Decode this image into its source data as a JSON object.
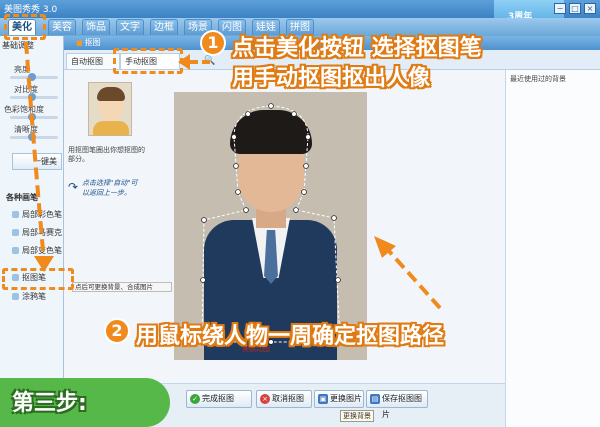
{
  "app": {
    "title": "美图秀秀 3.0",
    "logo_text": "3周年"
  },
  "window_controls": {
    "minimize": "−",
    "maximize": "□",
    "close": "×"
  },
  "main_tabs": [
    {
      "label": "美化"
    },
    {
      "label": "美容"
    },
    {
      "label": "饰品"
    },
    {
      "label": "文字"
    },
    {
      "label": "边框"
    },
    {
      "label": "场景"
    },
    {
      "label": "闪图"
    },
    {
      "label": "娃娃"
    },
    {
      "label": "拼图"
    }
  ],
  "left_panel": {
    "header": "基础调整",
    "sliders": [
      {
        "label": "亮度"
      },
      {
        "label": "对比度"
      },
      {
        "label": "色彩饱和度"
      },
      {
        "label": "清晰度"
      }
    ],
    "one_click_button": "一键美",
    "section_title": "各种画笔",
    "tools": [
      {
        "label": "局部彩色笔"
      },
      {
        "label": "局部马赛克"
      },
      {
        "label": "局部变色笔"
      },
      {
        "label": "抠图笔"
      },
      {
        "label": "涂鸦笔"
      }
    ]
  },
  "dialog": {
    "title": "抠图",
    "tabs": {
      "auto": "自动抠图",
      "manual": "手动抠图"
    },
    "preview_hint": "用抠图笔圈出你想抠图的部分。",
    "handwritten_tip": "点击选择\"自动\"可以返回上一步。",
    "right_panel_label": "最近使用过的背景",
    "watermark": "美丽动图",
    "small_tip": "点后可更换背景、合成图片",
    "buttons": {
      "done": "完成抠图",
      "cancel": "取消抠图",
      "replace": "更换图片",
      "save": "保存抠图图片"
    },
    "tooltip": "更换背景"
  },
  "tutorial": {
    "step1_number": "1",
    "step1_line1": "点击美化按钮 选择抠图笔",
    "step1_line2": "用手动抠图抠出人像",
    "step2_number": "2",
    "step2_text": "用鼠标绕人物一周确定抠图路径",
    "step_banner": "第三步:",
    "accent_color": "#f08a1c",
    "banner_color": "#55b848"
  }
}
